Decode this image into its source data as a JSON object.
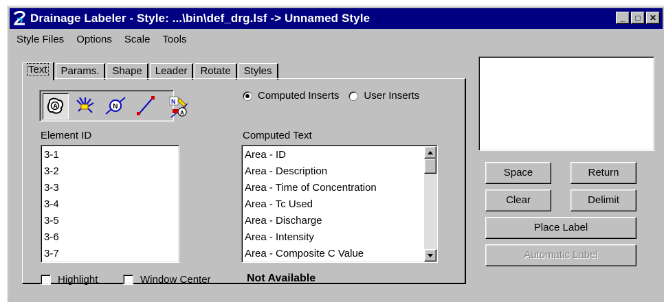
{
  "window": {
    "title": "Drainage Labeler - Style: ...\\bin\\def_drg.lsf -> Unnamed Style",
    "controls": {
      "minimize": "_",
      "maximize": "□",
      "close": "✕"
    }
  },
  "menu": [
    {
      "label": "Style Files"
    },
    {
      "label": "Options"
    },
    {
      "label": "Scale"
    },
    {
      "label": "Tools"
    }
  ],
  "tabs": [
    {
      "label": "Text",
      "active": true
    },
    {
      "label": "Params."
    },
    {
      "label": "Shape"
    },
    {
      "label": "Leader"
    },
    {
      "label": "Rotate"
    },
    {
      "label": "Styles"
    }
  ],
  "toolbar": {
    "tools": [
      "area-tool-icon",
      "inlet-tool-icon",
      "node-tool-icon",
      "link-tool-icon"
    ],
    "pressed_index": 0,
    "extra": "element-tag-icon"
  },
  "inserts": {
    "computed_label": "Computed Inserts",
    "user_label": "User Inserts",
    "selected": "computed"
  },
  "element_id": {
    "label": "Element ID",
    "items": [
      "3-1",
      "3-2",
      "3-3",
      "3-4",
      "3-5",
      "3-6",
      "3-7"
    ]
  },
  "computed_text": {
    "label": "Computed Text",
    "items": [
      "Area - ID",
      "Area - Description",
      "Area - Time of Concentration",
      "Area - Tc Used",
      "Area - Discharge",
      "Area - Intensity",
      "Area - Composite C Value"
    ]
  },
  "options": {
    "highlight_label": "Highlight",
    "highlight_checked": false,
    "window_center_label": "Window Center",
    "window_center_checked": false
  },
  "status": "Not Available",
  "buttons": {
    "space": "Space",
    "return": "Return",
    "clear": "Clear",
    "delimit": "Delimit",
    "place_label": "Place Label",
    "automatic_label": "Automatic Label"
  }
}
